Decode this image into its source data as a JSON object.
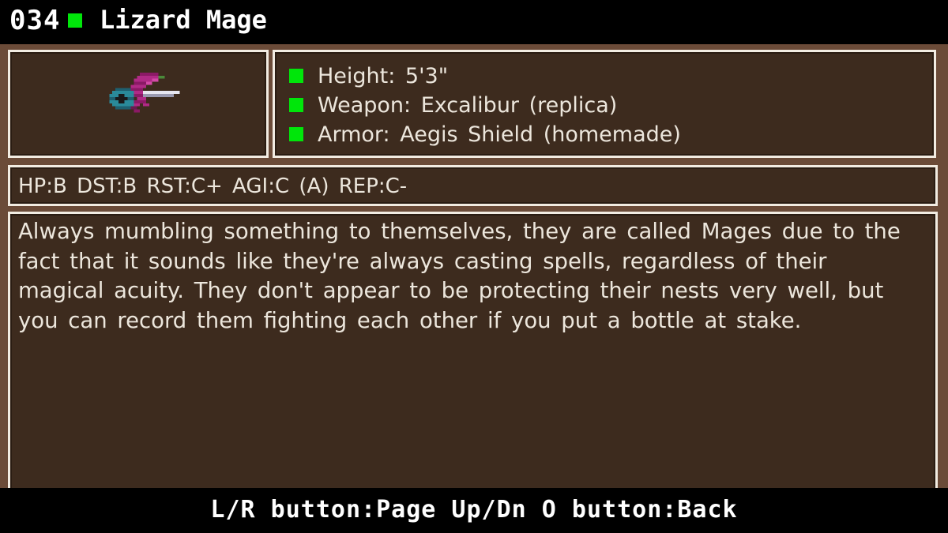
{
  "header": {
    "entry_number": "034",
    "name": "Lizard Mage",
    "accent_color": "#00e60a"
  },
  "portrait": {
    "icon": "lizard-mage-sprite-icon"
  },
  "info": {
    "rows": [
      {
        "text": "Height:  5'3\""
      },
      {
        "text": "Weapon:  Excalibur  (replica)"
      },
      {
        "text": "Armor:  Aegis  Shield  (homemade)"
      }
    ]
  },
  "stats": {
    "text": "HP:B  DST:B  RST:C+  AGI:C  (A)  REP:C-"
  },
  "description": {
    "text": "Always mumbling something to themselves, they are called Mages due to the fact that it sounds like they're always casting spells, regardless of their magical acuity. They don't appear to be protecting their nests very well, but you can record them fighting each other if you put a bottle at stake."
  },
  "footer": {
    "text": "L/R button:Page Up/Dn O button:Back"
  },
  "colors": {
    "board": "#6b4b38",
    "panel": "#3d2b1e",
    "border": "#f2ece2"
  }
}
